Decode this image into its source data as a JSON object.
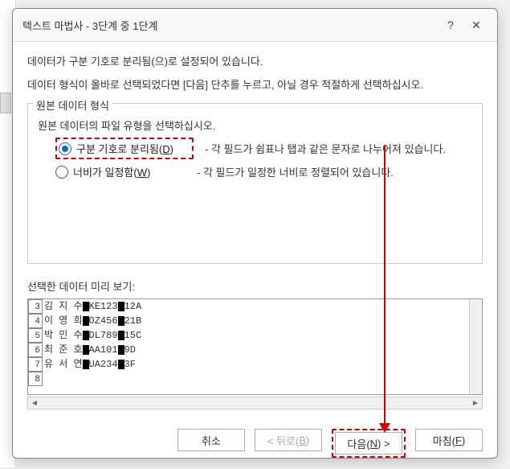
{
  "titlebar": {
    "title": "텍스트 마법사 - 3단계 중 1단계",
    "help": "?",
    "close": "✕"
  },
  "body": {
    "info1": "데이터가 구분 기호로 분리됨(으)로 설정되어 있습니다.",
    "info2": "데이터 형식이 올바로 선택되었다면 [다음] 단추를 누르고, 아닐 경우 적절하게 선택하십시오.",
    "groupbox_title": "원본 데이터 형식",
    "groupbox_instruction": "원본 데이터의 파일 유형을 선택하십시오.",
    "radio1": {
      "label_pre": "구분 기호로 분리됨(",
      "accel": "D",
      "label_post": ")",
      "desc": "- 각 필드가 쉼표나 탭과 같은 문자로 나누어져 있습니다."
    },
    "radio2": {
      "label_pre": "너비가 일정함(",
      "accel": "W",
      "label_post": ")",
      "desc": "- 각 필드가 일정한 너비로 정렬되어 있습니다."
    },
    "preview_label": "선택한 데이터 미리 보기:",
    "rows": [
      {
        "num": "3",
        "p1": "김 지 수",
        "p2": "KE123",
        "p3": "12A"
      },
      {
        "num": "4",
        "p1": "이 영 희",
        "p2": "OZ456",
        "p3": "21B"
      },
      {
        "num": "5",
        "p1": "박 민 수",
        "p2": "DL789",
        "p3": "15C"
      },
      {
        "num": "6",
        "p1": "최 준 호",
        "p2": "AA101",
        "p3": "9D"
      },
      {
        "num": "7",
        "p1": "유 서 연",
        "p2": "UA234",
        "p3": "3F"
      },
      {
        "num": "8",
        "p1": "",
        "p2": "",
        "p3": ""
      }
    ]
  },
  "buttons": {
    "cancel": "취소",
    "back_pre": "< 뒤로(",
    "back_accel": "B",
    "back_post": ")",
    "next_pre": "다음(",
    "next_accel": "N",
    "next_post": ") >",
    "finish_pre": "마침(",
    "finish_accel": "F",
    "finish_post": ")"
  },
  "sheet": {
    "row_marker": ""
  }
}
